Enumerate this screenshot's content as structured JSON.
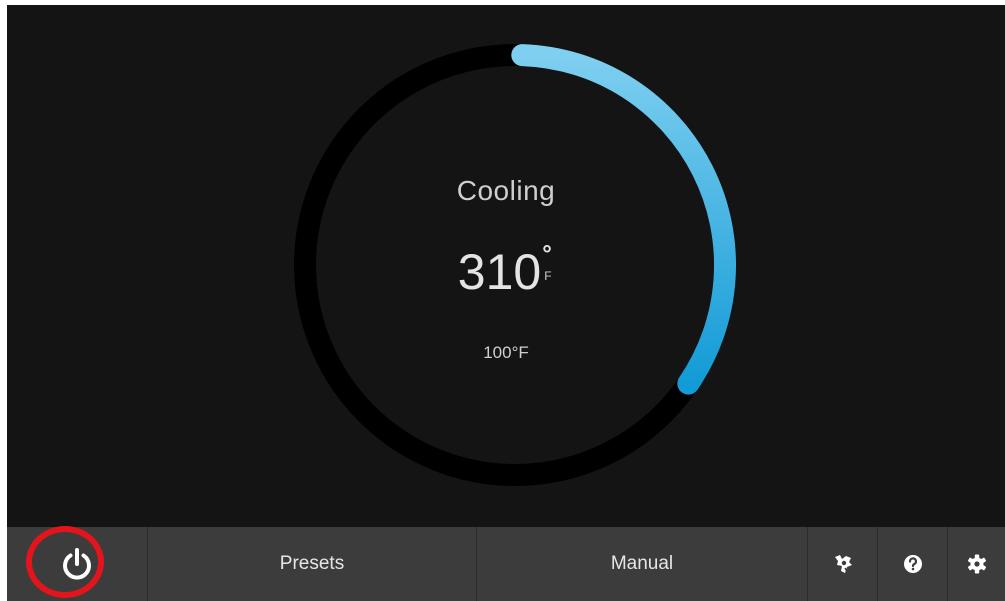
{
  "thermostat": {
    "mode": "Cooling",
    "current_temp": "310",
    "degree_symbol": "°",
    "unit": "F",
    "setpoint": "100°F",
    "arc_fraction": 0.34
  },
  "bottom_bar": {
    "power_icon": "power-icon",
    "presets_label": "Presets",
    "manual_label": "Manual",
    "fan_icon": "fan-hand-icon",
    "help_icon": "help-icon",
    "settings_icon": "gear-icon"
  },
  "colors": {
    "background": "#141414",
    "track": "#000000",
    "arc_start": "#7fcff0",
    "arc_end": "#129bd6",
    "bar": "#3c3c3c",
    "highlight": "#e3141b"
  }
}
